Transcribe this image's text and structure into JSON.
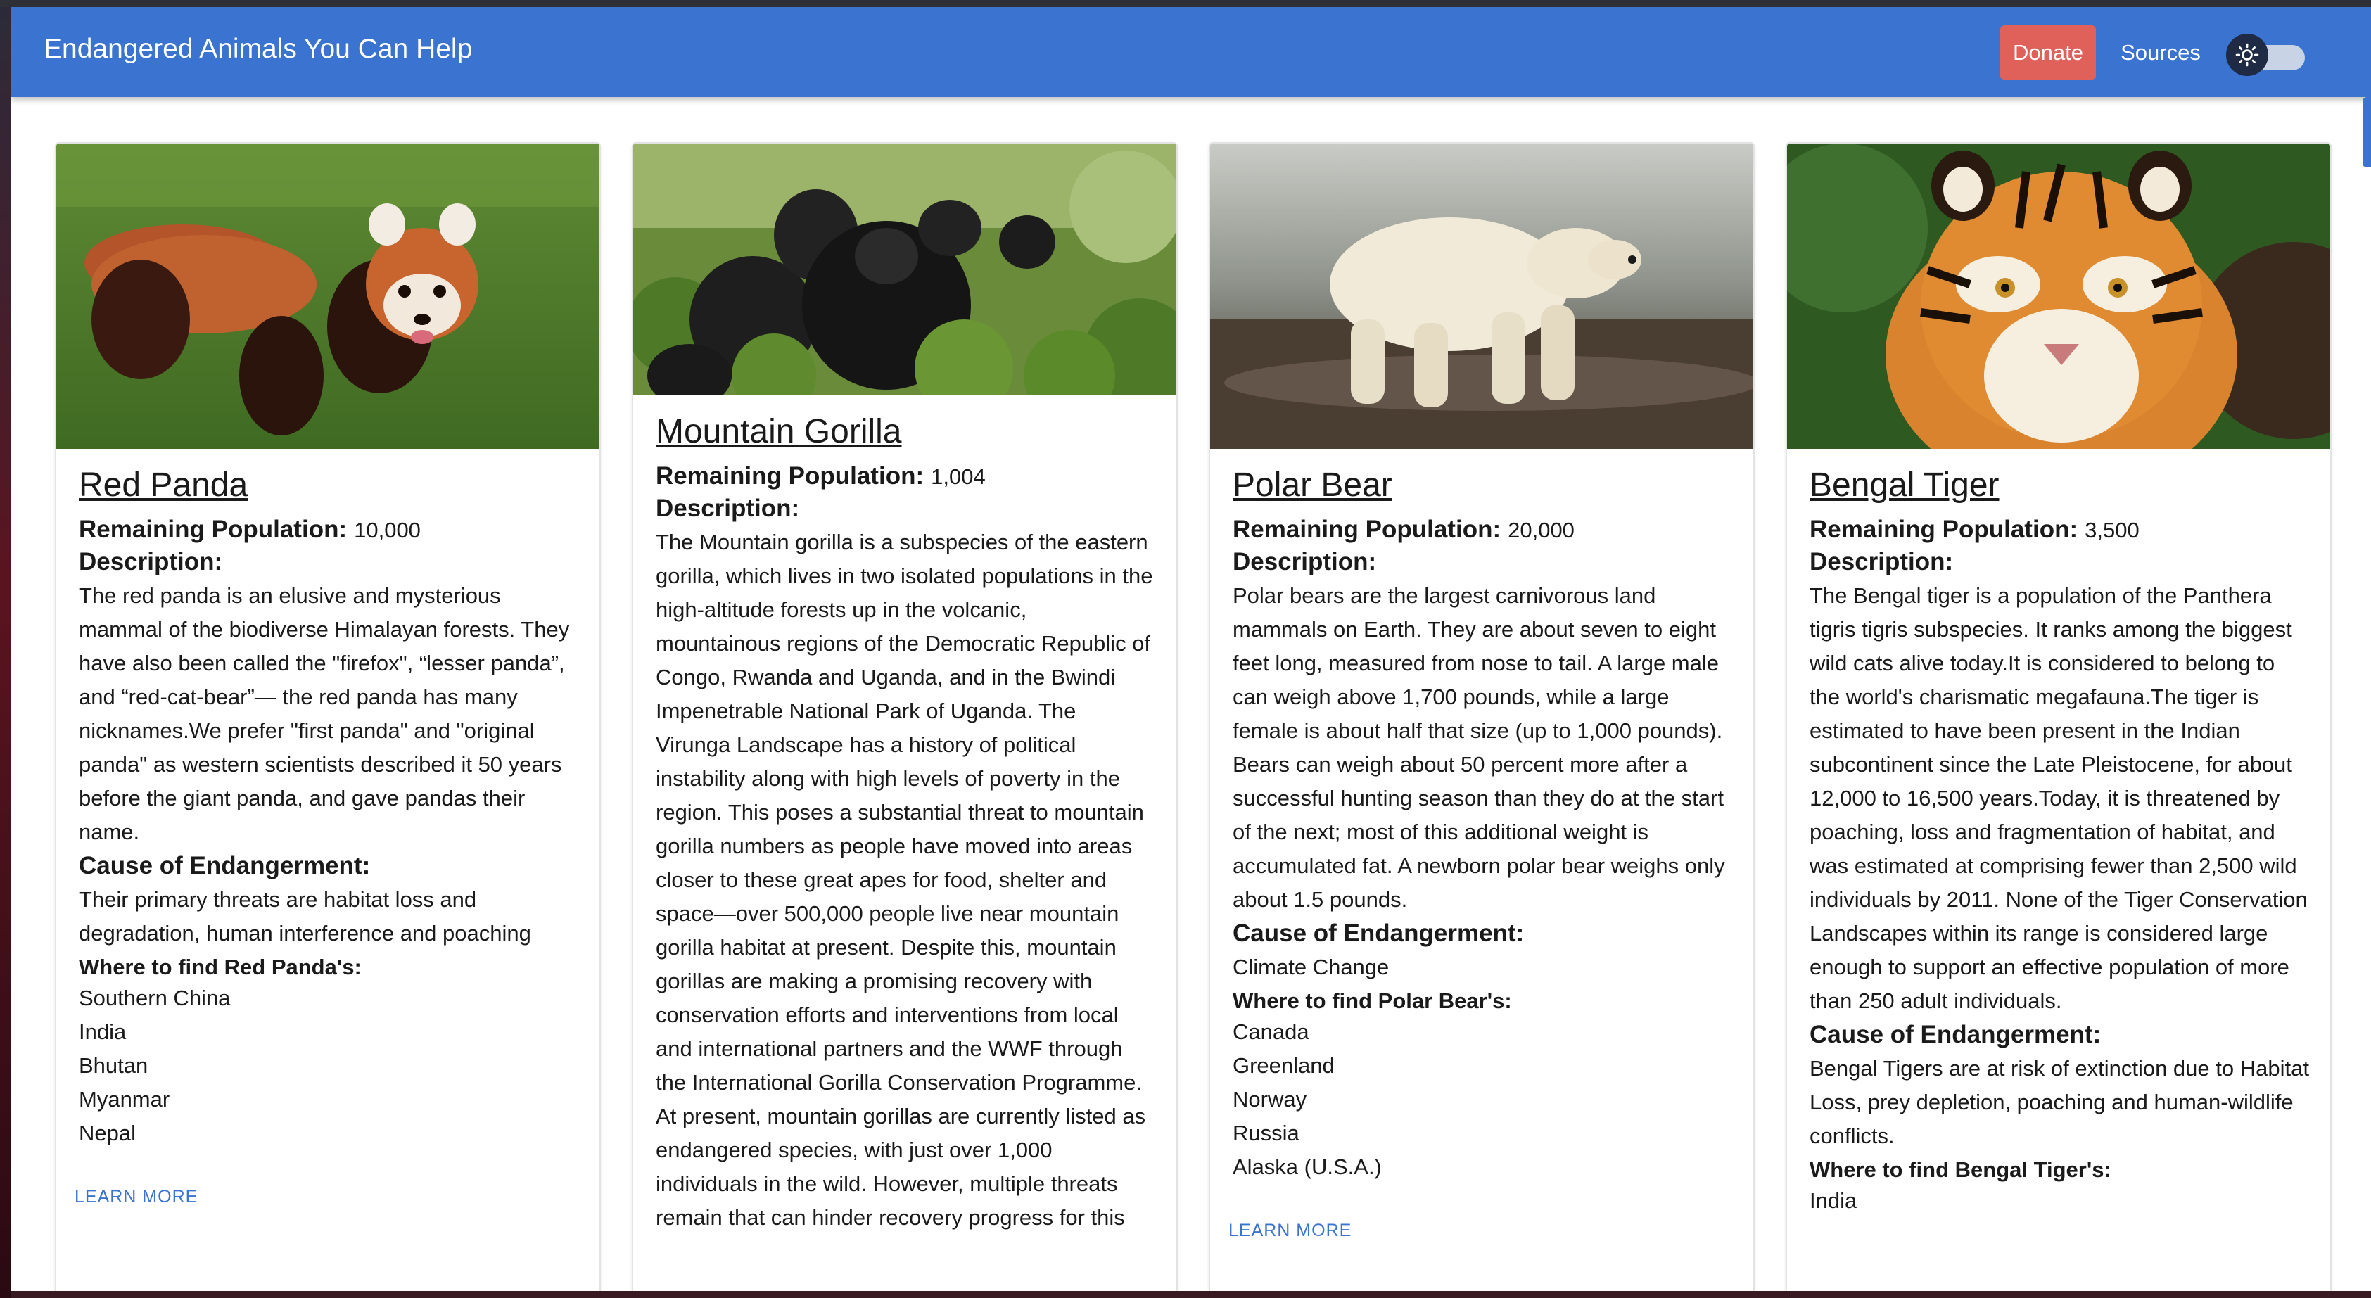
{
  "header": {
    "title": "Endangered Animals You Can Help",
    "donate_label": "Donate",
    "sources_label": "Sources",
    "theme_icon": "sun-icon"
  },
  "colors": {
    "appbar": "#3a74d0",
    "donate": "#e0605a",
    "link": "#3a74d0"
  },
  "labels": {
    "remaining_population": "Remaining Population:",
    "description": "Description:",
    "cause": "Cause of Endangerment:",
    "learn_more": "LEARN MORE"
  },
  "cards": [
    {
      "name": "Red Panda",
      "image": "red-panda-photo",
      "population": "10,000",
      "description": "The red panda is an elusive and mysterious mammal of the biodiverse Himalayan forests. They have also been called the \"firefox\", “lesser panda”, and “red-cat-bear”— the red panda has many nicknames.We prefer \"first panda\" and \"original panda\" as western scientists described it 50 years before the giant panda, and gave pandas their name.",
      "cause": "Their primary threats are habitat loss and degradation, human interference and poaching",
      "where_label": "Where to find Red Panda's:",
      "locations": [
        "Southern China",
        "India",
        "Bhutan",
        "Myanmar",
        "Nepal"
      ]
    },
    {
      "name": "Mountain Gorilla",
      "image": "mountain-gorilla-photo",
      "population": "1,004",
      "description": "The Mountain gorilla is a subspecies of the eastern gorilla, which lives in two isolated populations in the high-altitude forests up in the volcanic, mountainous regions of the Democratic Republic of Congo, Rwanda and Uganda, and in the Bwindi Impenetrable National Park of Uganda. The Virunga Landscape has a history of political instability along with high levels of poverty in the region. This poses a substantial threat to mountain gorilla numbers as people have moved into areas closer to these great apes for food, shelter and space—over 500,000 people live near mountain gorilla habitat at present. Despite this, mountain gorillas are making a promising recovery with conservation efforts and interventions from local and international partners and the WWF through the International Gorilla Conservation Programme. At present, mountain gorillas are currently listed as endangered species, with just over 1,000 individuals in the wild. However, multiple threats remain that can hinder recovery progress for this"
    },
    {
      "name": "Polar Bear",
      "image": "polar-bear-photo",
      "population": "20,000",
      "description": "Polar bears are the largest carnivorous land mammals on Earth. They are about seven to eight feet long, measured from nose to tail. A large male can weigh above 1,700 pounds, while a large female is about half that size (up to 1,000 pounds). Bears can weigh about 50 percent more after a successful hunting season than they do at the start of the next; most of this additional weight is accumulated fat. A newborn polar bear weighs only about 1.5 pounds.",
      "cause": "Climate Change",
      "where_label": "Where to find Polar Bear's:",
      "locations": [
        "Canada",
        "Greenland",
        "Norway",
        "Russia",
        "Alaska (U.S.A.)"
      ]
    },
    {
      "name": "Bengal Tiger",
      "image": "bengal-tiger-photo",
      "population": "3,500",
      "description": "The Bengal tiger is a population of the Panthera tigris tigris subspecies. It ranks among the biggest wild cats alive today.It is considered to belong to the world's charismatic megafauna.The tiger is estimated to have been present in the Indian subcontinent since the Late Pleistocene, for about 12,000 to 16,500 years.Today, it is threatened by poaching, loss and fragmentation of habitat, and was estimated at comprising fewer than 2,500 wild individuals by 2011. None of the Tiger Conservation Landscapes within its range is considered large enough to support an effective population of more than 250 adult individuals.",
      "cause": "Bengal Tigers are at risk of extinction due to Habitat Loss, prey depletion, poaching and human-wildlife conflicts.",
      "where_label": "Where to find Bengal Tiger's:",
      "locations": [
        "India"
      ]
    }
  ]
}
